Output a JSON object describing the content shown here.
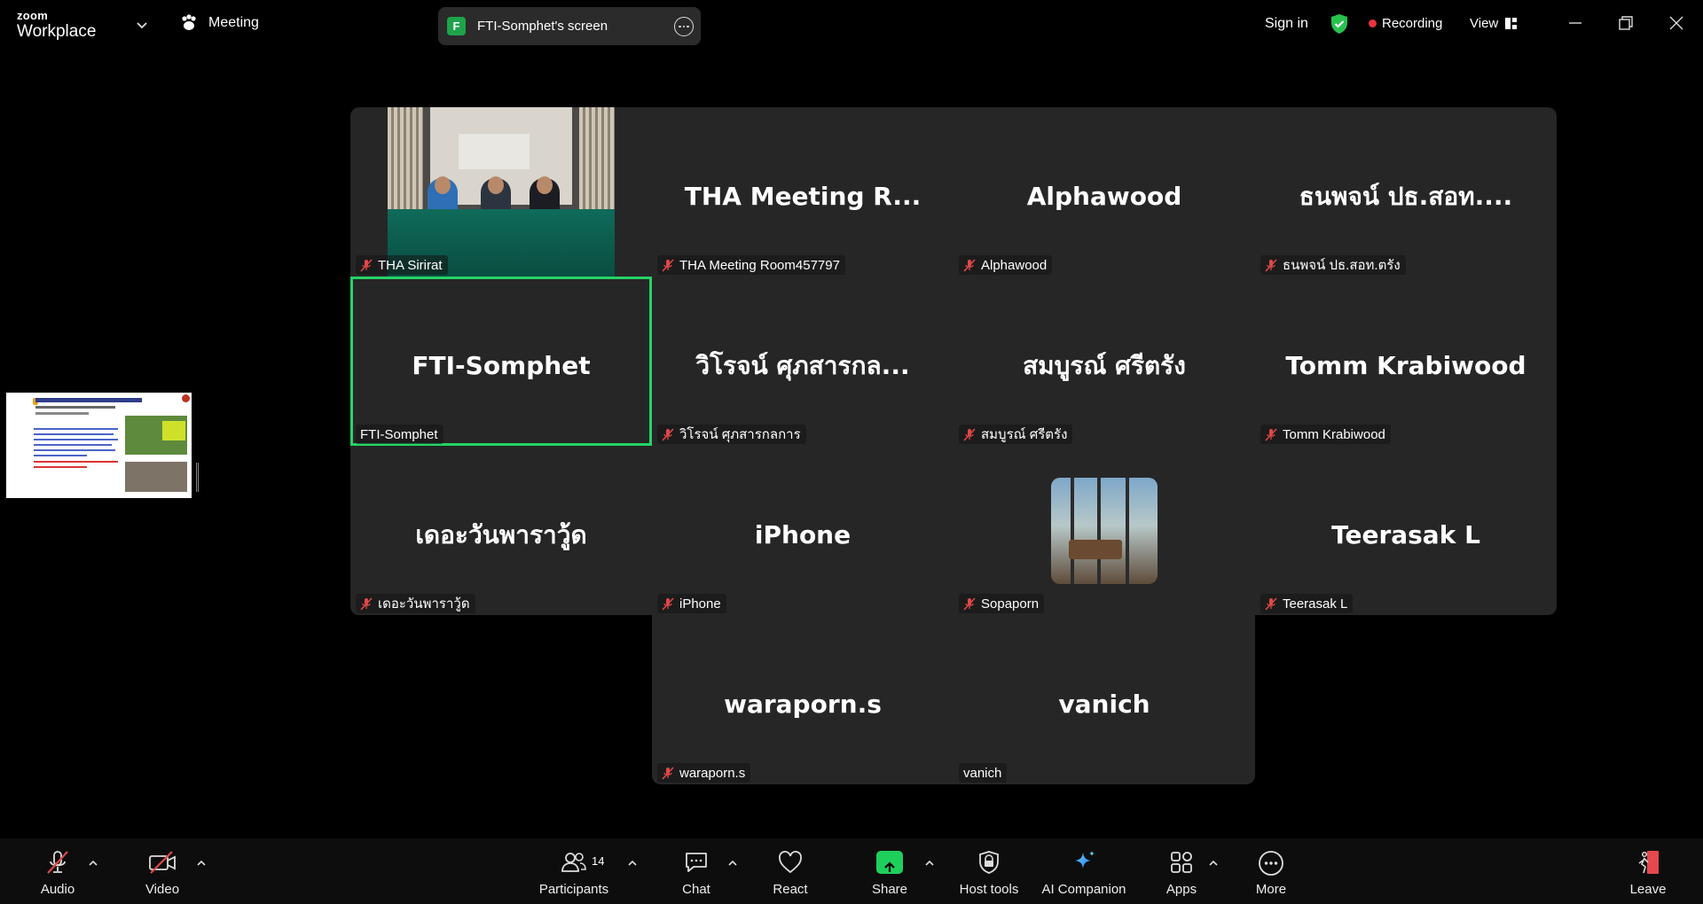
{
  "app": {
    "logo_top": "zoom",
    "logo_bottom": "Workplace"
  },
  "topbar": {
    "meeting_label": "Meeting",
    "share_badge": "F",
    "share_label": "FTI-Somphet's screen",
    "sign_in": "Sign in",
    "recording": "Recording",
    "view": "View",
    "accent_green": "#25d366",
    "recording_color": "#e9353b"
  },
  "tiles": [
    {
      "big": "",
      "name": "THA Sirirat",
      "muted": true,
      "video": true
    },
    {
      "big": "THA  Meeting  R...",
      "name": "THA Meeting Room457797",
      "muted": true
    },
    {
      "big": "Alphawood",
      "name": "Alphawood",
      "muted": true
    },
    {
      "big": "ธนพจน์ ปธ.สอท....",
      "name": "ธนพจน์ ปธ.สอท.ตรัง",
      "muted": true
    },
    {
      "big": "FTI-Somphet",
      "name": "FTI-Somphet",
      "muted": false,
      "active": true
    },
    {
      "big": "วิโรจน์ ศุภสารกล...",
      "name": "วิโรจน์ ศุภสารกลการ",
      "muted": true
    },
    {
      "big": "สมบูรณ์ ศรีตรัง",
      "name": "สมบูรณ์ ศรีตรัง",
      "muted": true
    },
    {
      "big": "Tomm Krabiwood",
      "name": "Tomm Krabiwood",
      "muted": true
    },
    {
      "big": "เดอะวันพาราวู้ด",
      "name": "เดอะวันพาราวู้ด",
      "muted": true
    },
    {
      "big": "iPhone",
      "name": "iPhone",
      "muted": true
    },
    {
      "big": "",
      "name": "Sopaporn",
      "muted": true,
      "avatar": true
    },
    {
      "big": "Teerasak L",
      "name": "Teerasak L",
      "muted": true
    },
    {
      "big": "waraporn.s",
      "name": "waraporn.s",
      "muted": true
    },
    {
      "big": "vanich",
      "name": "vanich",
      "muted": false
    }
  ],
  "toolbar": {
    "audio": "Audio",
    "video": "Video",
    "participants": "Participants",
    "participants_count": "14",
    "chat": "Chat",
    "react": "React",
    "share": "Share",
    "host_tools": "Host tools",
    "ai_companion": "AI Companion",
    "apps": "Apps",
    "more": "More",
    "leave": "Leave"
  }
}
